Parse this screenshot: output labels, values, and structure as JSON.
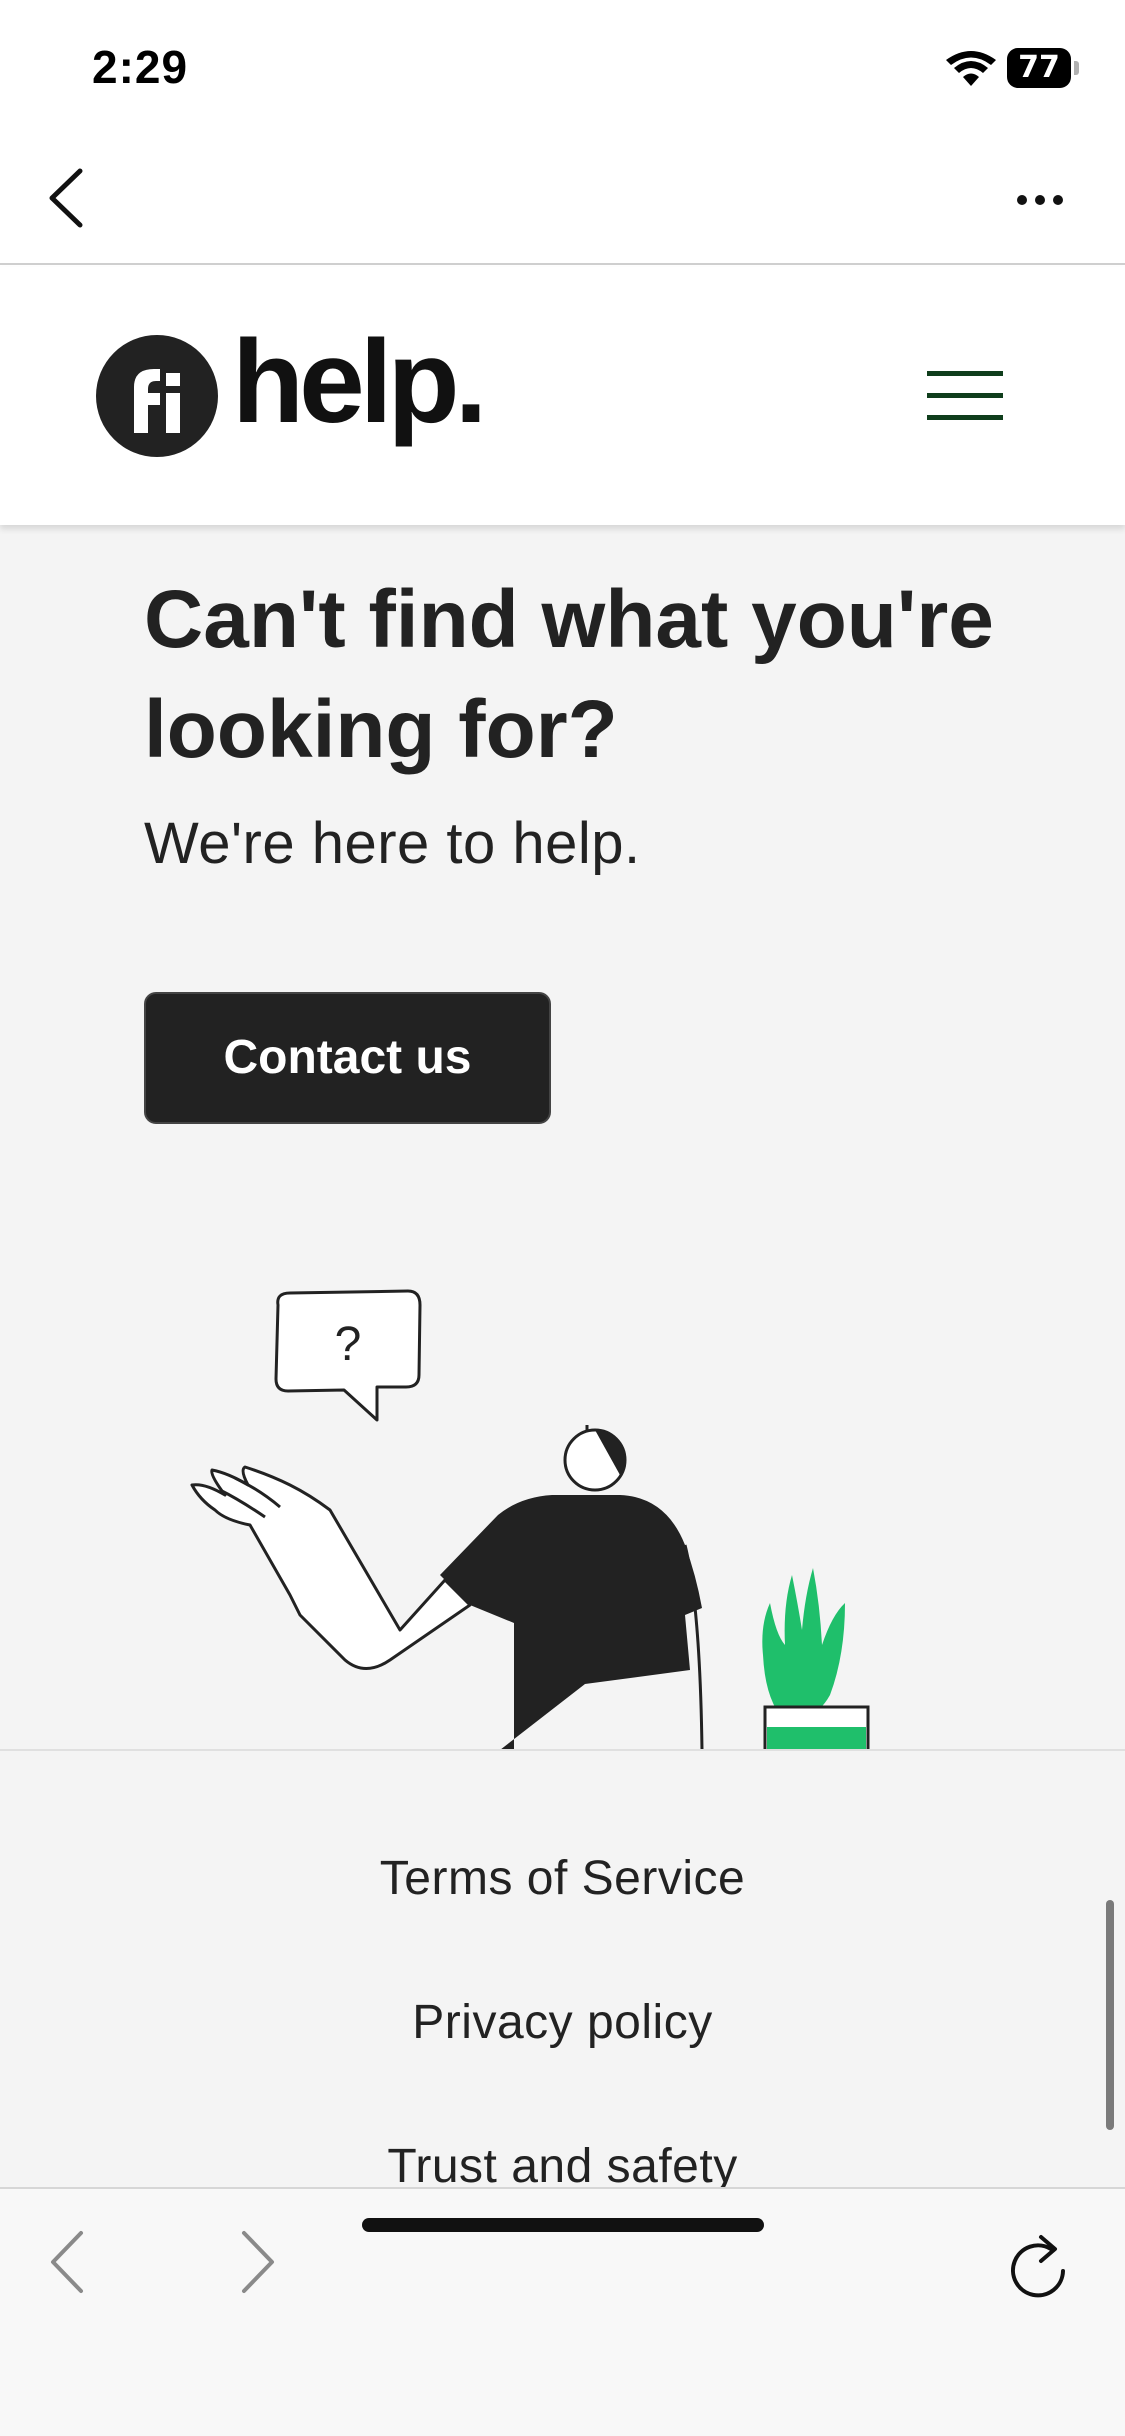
{
  "status_bar": {
    "time": "2:29",
    "battery": "77"
  },
  "site": {
    "logo_mark": "fi",
    "logo_text": "help."
  },
  "main": {
    "heading": "Can't find what you're looking for?",
    "subheading": "We're here to help.",
    "contact_button": "Contact us",
    "illustration_text": "?"
  },
  "footer": {
    "links": [
      "Terms of Service",
      "Privacy policy",
      "Trust and safety"
    ]
  },
  "colors": {
    "dark": "#222222",
    "accent_green": "#1fbf6b",
    "menu_green": "#0f3d1c",
    "background": "#f4f4f4"
  }
}
